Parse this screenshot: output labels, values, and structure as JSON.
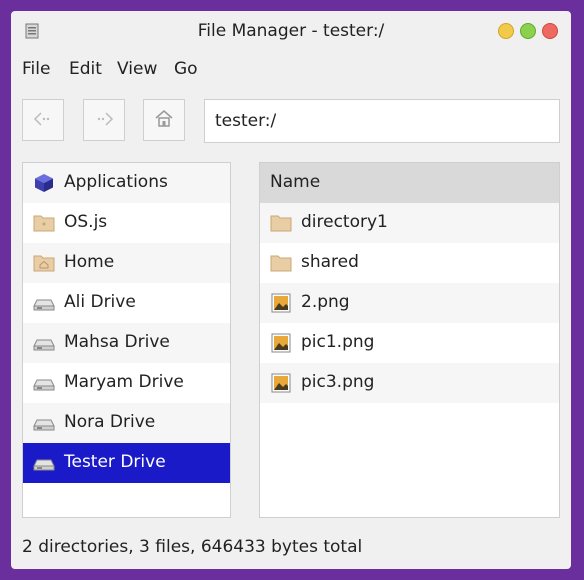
{
  "window": {
    "title": "File Manager - tester:/",
    "icon": "file-manager-icon",
    "controls": [
      "minimize",
      "maximize",
      "close"
    ]
  },
  "menu": [
    "File",
    "Edit",
    "View",
    "Go"
  ],
  "toolbar": {
    "back_icon": "back-arrow-icon",
    "forward_icon": "forward-arrow-icon",
    "home_icon": "home-icon",
    "address": "tester:/"
  },
  "sidebar": {
    "items": [
      {
        "label": "Applications",
        "icon": "applications-cube-icon"
      },
      {
        "label": "OS.js",
        "icon": "folder-icon"
      },
      {
        "label": "Home",
        "icon": "home-folder-icon"
      },
      {
        "label": "Ali Drive",
        "icon": "drive-icon"
      },
      {
        "label": "Mahsa Drive",
        "icon": "drive-icon"
      },
      {
        "label": "Maryam Drive",
        "icon": "drive-icon"
      },
      {
        "label": "Nora Drive",
        "icon": "drive-icon"
      },
      {
        "label": "Tester Drive",
        "icon": "drive-icon",
        "selected": true
      }
    ]
  },
  "files": {
    "header": "Name",
    "rows": [
      {
        "name": "directory1",
        "icon": "folder-icon"
      },
      {
        "name": "shared",
        "icon": "folder-icon"
      },
      {
        "name": "2.png",
        "icon": "image-icon"
      },
      {
        "name": "pic1.png",
        "icon": "image-icon"
      },
      {
        "name": "pic3.png",
        "icon": "image-icon"
      }
    ]
  },
  "status": "2 directories, 3 files, 646433 bytes total",
  "colors": {
    "desktop": "#6a2f9c",
    "selection": "#1a1ac8",
    "column_header": "#d9d9d9",
    "folder": "#e9cda4"
  }
}
